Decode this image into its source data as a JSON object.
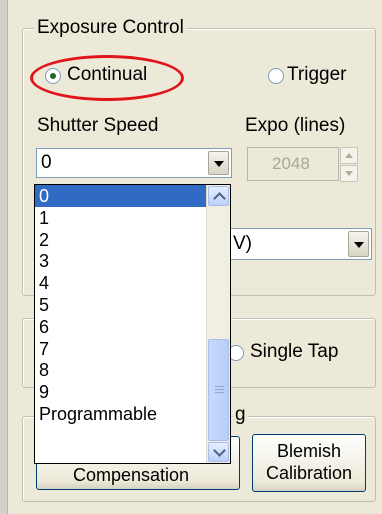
{
  "exposure_group": {
    "title": "Exposure Control",
    "mode_continual": "Continual",
    "mode_trigger": "Trigger",
    "shutter_label": "Shutter Speed",
    "shutter_value": "0",
    "expo_label": "Expo (lines)",
    "expo_value": "2048",
    "second_combo_partial": "V)"
  },
  "shutter_dropdown": {
    "options": [
      "0",
      "1",
      "2",
      "3",
      "4",
      "5",
      "6",
      "7",
      "8",
      "9",
      "Programmable"
    ],
    "selected": "0"
  },
  "tap_group": {
    "single_tap": "Single Tap"
  },
  "bottom_group": {
    "title_fragment": "g",
    "blemish_line1": "Blemish",
    "blemish_line2": "Calibration",
    "compensation_label": "Compensation"
  },
  "colors": {
    "highlight": "#e0151b",
    "selection": "#316ac5"
  }
}
